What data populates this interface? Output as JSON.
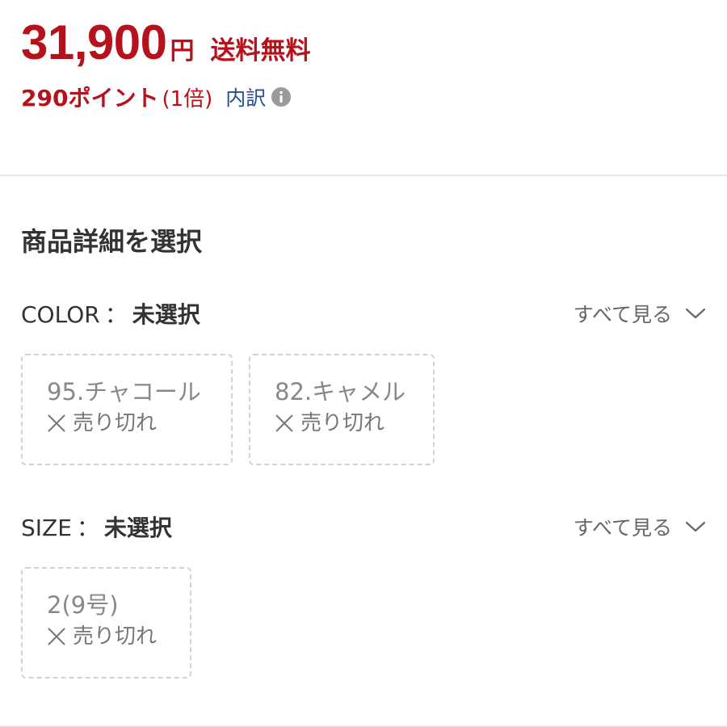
{
  "price": {
    "value": "31,900",
    "unit": "円",
    "shipping": "送料無料"
  },
  "points": {
    "text": "290ポイント",
    "multiplier": "(1倍)",
    "breakdown_label": "内訳",
    "info_icon": "info-icon"
  },
  "product_options": {
    "title": "商品詳細を選択",
    "color": {
      "label": "COLOR",
      "separator": "：",
      "state": "未選択",
      "see_all": "すべて見る",
      "options": [
        {
          "name": "95.チャコール",
          "status": "売り切れ"
        },
        {
          "name": "82.キャメル",
          "status": "売り切れ"
        }
      ]
    },
    "size": {
      "label": "SIZE",
      "separator": "：",
      "state": "未選択",
      "see_all": "すべて見る",
      "options": [
        {
          "name": "2(9号)",
          "status": "売り切れ"
        }
      ]
    }
  },
  "colors": {
    "price_red": "#b5121b",
    "link_blue": "#1f4e96",
    "text_gray": "#666666",
    "chip_border": "#d2d2d2"
  }
}
